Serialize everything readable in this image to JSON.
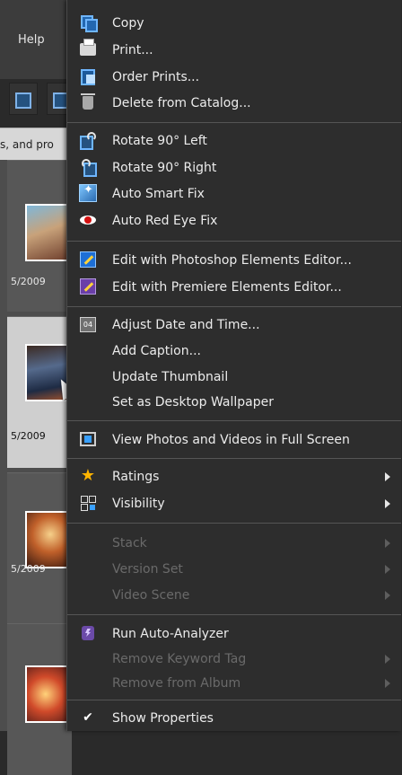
{
  "background": {
    "menubar_help": "Help",
    "search_text": "s, and pro",
    "thumbnail_dates": [
      "5/2009",
      "5/2009",
      "5/2009"
    ]
  },
  "menu": {
    "items": [
      {
        "label": "Copy",
        "icon": "copy-icon",
        "enabled": true
      },
      {
        "label": "Print...",
        "icon": "print-icon",
        "enabled": true
      },
      {
        "label": "Order Prints...",
        "icon": "order-prints-icon",
        "enabled": true
      },
      {
        "label": "Delete from Catalog...",
        "icon": "trash-icon",
        "enabled": true
      },
      {
        "label": "Rotate 90° Left",
        "icon": "rotate-left-icon",
        "enabled": true
      },
      {
        "label": "Rotate 90° Right",
        "icon": "rotate-right-icon",
        "enabled": true
      },
      {
        "label": "Auto Smart Fix",
        "icon": "smart-fix-icon",
        "enabled": true
      },
      {
        "label": "Auto Red Eye Fix",
        "icon": "red-eye-icon",
        "enabled": true
      },
      {
        "label": "Edit with Photoshop Elements Editor...",
        "icon": "photoshop-elements-icon",
        "enabled": true
      },
      {
        "label": "Edit with Premiere Elements Editor...",
        "icon": "premiere-elements-icon",
        "enabled": true
      },
      {
        "label": "Adjust Date and Time...",
        "icon": "calendar-icon",
        "enabled": true
      },
      {
        "label": "Add Caption...",
        "icon": "",
        "enabled": true
      },
      {
        "label": "Update Thumbnail",
        "icon": "",
        "enabled": true
      },
      {
        "label": "Set as Desktop Wallpaper",
        "icon": "",
        "enabled": true
      },
      {
        "label": "View Photos and Videos in Full Screen",
        "icon": "full-screen-icon",
        "enabled": true
      },
      {
        "label": "Ratings",
        "icon": "star-icon",
        "enabled": true,
        "submenu": true
      },
      {
        "label": "Visibility",
        "icon": "visibility-icon",
        "enabled": true,
        "submenu": true
      },
      {
        "label": "Stack",
        "icon": "",
        "enabled": false,
        "submenu": true
      },
      {
        "label": "Version Set",
        "icon": "",
        "enabled": false,
        "submenu": true
      },
      {
        "label": "Video Scene",
        "icon": "",
        "enabled": false,
        "submenu": true
      },
      {
        "label": "Run Auto-Analyzer",
        "icon": "auto-analyzer-icon",
        "enabled": true
      },
      {
        "label": "Remove Keyword Tag",
        "icon": "",
        "enabled": false,
        "submenu": true
      },
      {
        "label": "Remove from Album",
        "icon": "",
        "enabled": false,
        "submenu": true
      },
      {
        "label": "Show Properties",
        "icon": "checkmark-icon",
        "enabled": true,
        "checked": true
      }
    ]
  }
}
